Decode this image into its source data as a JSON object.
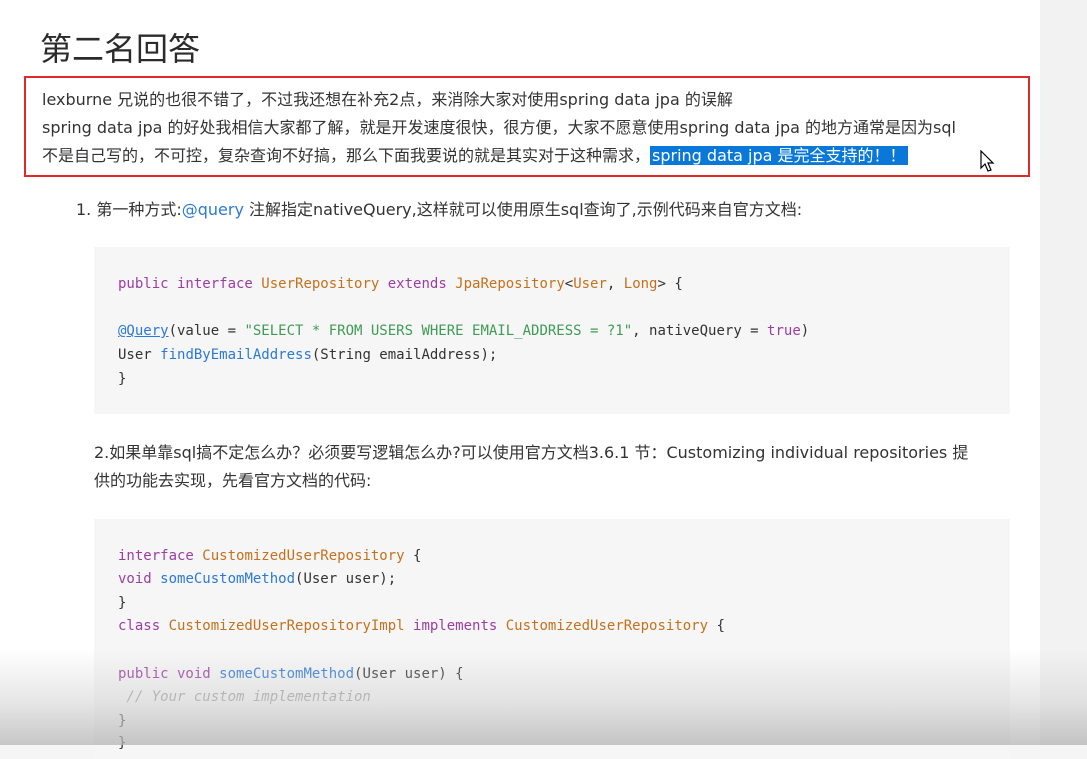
{
  "title": "第二名回答",
  "callout": {
    "line1": "lexburne 兄说的也很不错了，不过我还想在补充2点，来消除大家对使用spring data jpa 的误解",
    "line2": "spring data jpa 的好处我相信大家都了解，就是开发速度很快，很方便，大家不愿意使用spring data jpa 的地方通常是因为sql",
    "line3_plain": "不是自己写的，不可控，复杂查询不好搞，那么下面我要说的就是其实对于这种需求，",
    "line3_selected": "spring data jpa 是完全支持的！！",
    "border_color": "#e0292b",
    "selection_color": "#0a78d8"
  },
  "item1": {
    "prefix": "1. 第一种方式:",
    "link": "@query",
    "suffix": " 注解指定nativeQuery,这样就可以使用原生sql查询了,示例代码来自官方文档:"
  },
  "code1": {
    "l1": {
      "a": "public interface ",
      "b": "UserRepository",
      "c": " extends ",
      "d": "JpaRepository",
      "e": "<",
      "f": "User",
      "g": ", ",
      "h": "Long",
      "i": "> {"
    },
    "l2": {
      "a": "@Query",
      "b": "(value = ",
      "c": "\"SELECT * FROM USERS WHERE EMAIL_ADDRESS = ?1\"",
      "d": ", nativeQuery = ",
      "e": "true",
      "f": ")"
    },
    "l3": {
      "a": "User ",
      "b": "findByEmailAddress",
      "c": "(String emailAddress);"
    },
    "l4": "}"
  },
  "item2": {
    "line1": "2.如果单靠sql搞不定怎么办？必须要写逻辑怎么办?可以使用官方文档3.6.1 节：Customizing individual repositories 提",
    "line2": "供的功能去实现，先看官方文档的代码:"
  },
  "code2": {
    "l1": {
      "a": "interface ",
      "b": "CustomizedUserRepository",
      "c": " {"
    },
    "l2": {
      "a": "void ",
      "b": "someCustomMethod",
      "c": "(User user);"
    },
    "l3": "}",
    "l4": {
      "a": "class ",
      "b": "CustomizedUserRepositoryImpl",
      "c": " implements ",
      "d": "CustomizedUserRepository",
      "e": " {"
    },
    "l5": {
      "a": "public void ",
      "b": "someCustomMethod",
      "c": "(User user) {"
    },
    "l6": " // Your custom implementation",
    "l7": "}",
    "l8": "}"
  }
}
